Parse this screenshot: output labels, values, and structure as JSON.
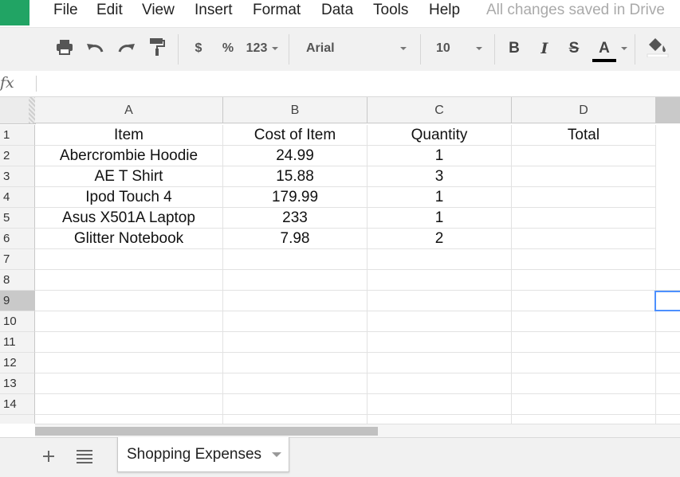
{
  "menu": {
    "items": [
      "File",
      "Edit",
      "View",
      "Insert",
      "Format",
      "Data",
      "Tools",
      "Help"
    ],
    "save_status": "All changes saved in Drive"
  },
  "toolbar": {
    "currency_label": "$",
    "percent_label": "%",
    "number_format_label": "123",
    "font_name": "Arial",
    "font_size": "10",
    "bold_label": "B",
    "italic_label": "I",
    "strike_label": "S",
    "text_color_label": "A",
    "text_color": "#000000"
  },
  "formula_bar": {
    "fx_label": "fx",
    "value": ""
  },
  "sheet": {
    "columns": [
      "A",
      "B",
      "C",
      "D"
    ],
    "row_numbers": [
      "1",
      "2",
      "3",
      "4",
      "5",
      "6",
      "7",
      "8",
      "9",
      "10",
      "11",
      "12",
      "13",
      "14"
    ],
    "selected_row": "9",
    "rows": [
      [
        "Item",
        "Cost of Item",
        "Quantity",
        "Total"
      ],
      [
        "Abercrombie Hoodie",
        "24.99",
        "1",
        ""
      ],
      [
        "AE T Shirt",
        "15.88",
        "3",
        ""
      ],
      [
        "Ipod Touch 4",
        "179.99",
        "1",
        ""
      ],
      [
        "Asus X501A Laptop",
        "233",
        "1",
        ""
      ],
      [
        "Glitter Notebook",
        "7.98",
        "2",
        ""
      ]
    ]
  },
  "tabs": {
    "active_sheet": "Shopping Expenses"
  },
  "colors": {
    "brand_green": "#21a464",
    "selection_blue": "#4d90fe"
  }
}
